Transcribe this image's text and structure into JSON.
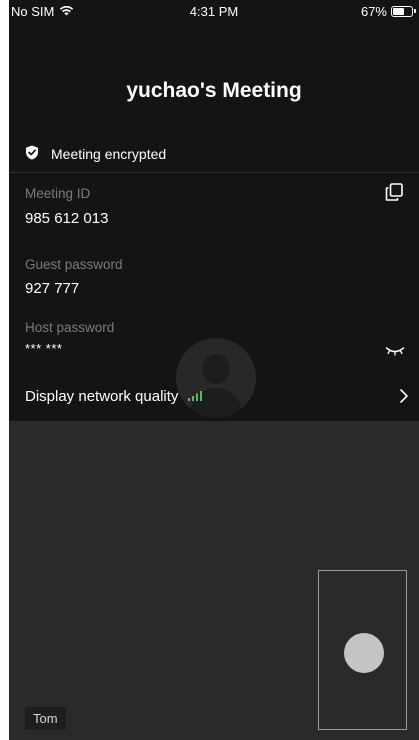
{
  "status_bar": {
    "carrier": "No SIM",
    "time": "4:31 PM",
    "battery": "67%",
    "battery_level": 0.67
  },
  "meeting": {
    "title": "yuchao's Meeting",
    "encryption_text": "Meeting encrypted"
  },
  "fields": {
    "meeting_id_label": "Meeting ID",
    "meeting_id_value": "985 612 013",
    "guest_password_label": "Guest password",
    "guest_password_value": "927 777",
    "host_password_label": "Host password",
    "host_password_value": "*** ***"
  },
  "network": {
    "label": "Display network quality",
    "signal_color": "#3ec95a"
  },
  "video": {
    "participant_name": "Tom"
  },
  "icons": {
    "wifi": "wifi-icon",
    "battery": "battery-icon",
    "shield": "shield-check-icon",
    "copy": "copy-icon",
    "eye_closed": "eye-closed-icon",
    "signal": "signal-bars-icon",
    "chevron": "chevron-right-icon"
  }
}
